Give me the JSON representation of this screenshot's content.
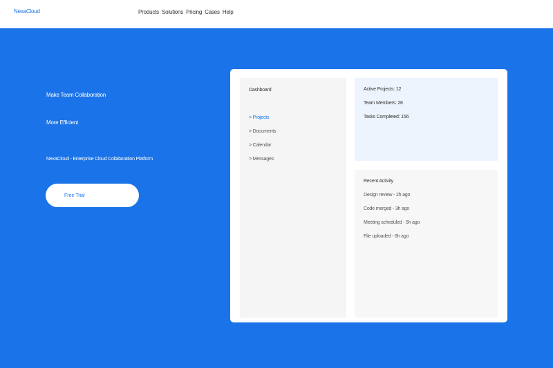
{
  "brand": {
    "logo": "NexaCloud"
  },
  "nav": [
    "Products",
    "Solutions",
    "Pricing",
    "Cases",
    "Help"
  ],
  "hero": {
    "line1": "Make Team Collaboration",
    "line2": "More Efficient",
    "subtitle": "NexaCloud - Enterprise Cloud Collaboration Platform",
    "cta": "Free Trial"
  },
  "dashboard": {
    "title": "Dashboard",
    "items": [
      "> Projects",
      "> Documents",
      "> Calendar",
      "> Messages"
    ],
    "stats": [
      "Active Projects: 12",
      "Team Members: 28",
      "Tasks Completed: 156"
    ],
    "activity_title": "Recent Activity",
    "activity": [
      "Design review - 2h ago",
      "Code merged - 3h ago",
      "Meeting scheduled - 5h ago",
      "File uploaded - 6h ago"
    ]
  },
  "colors": {
    "brand": "#1a73e8",
    "background": "#1a73e8",
    "panel": "#ffffff"
  }
}
